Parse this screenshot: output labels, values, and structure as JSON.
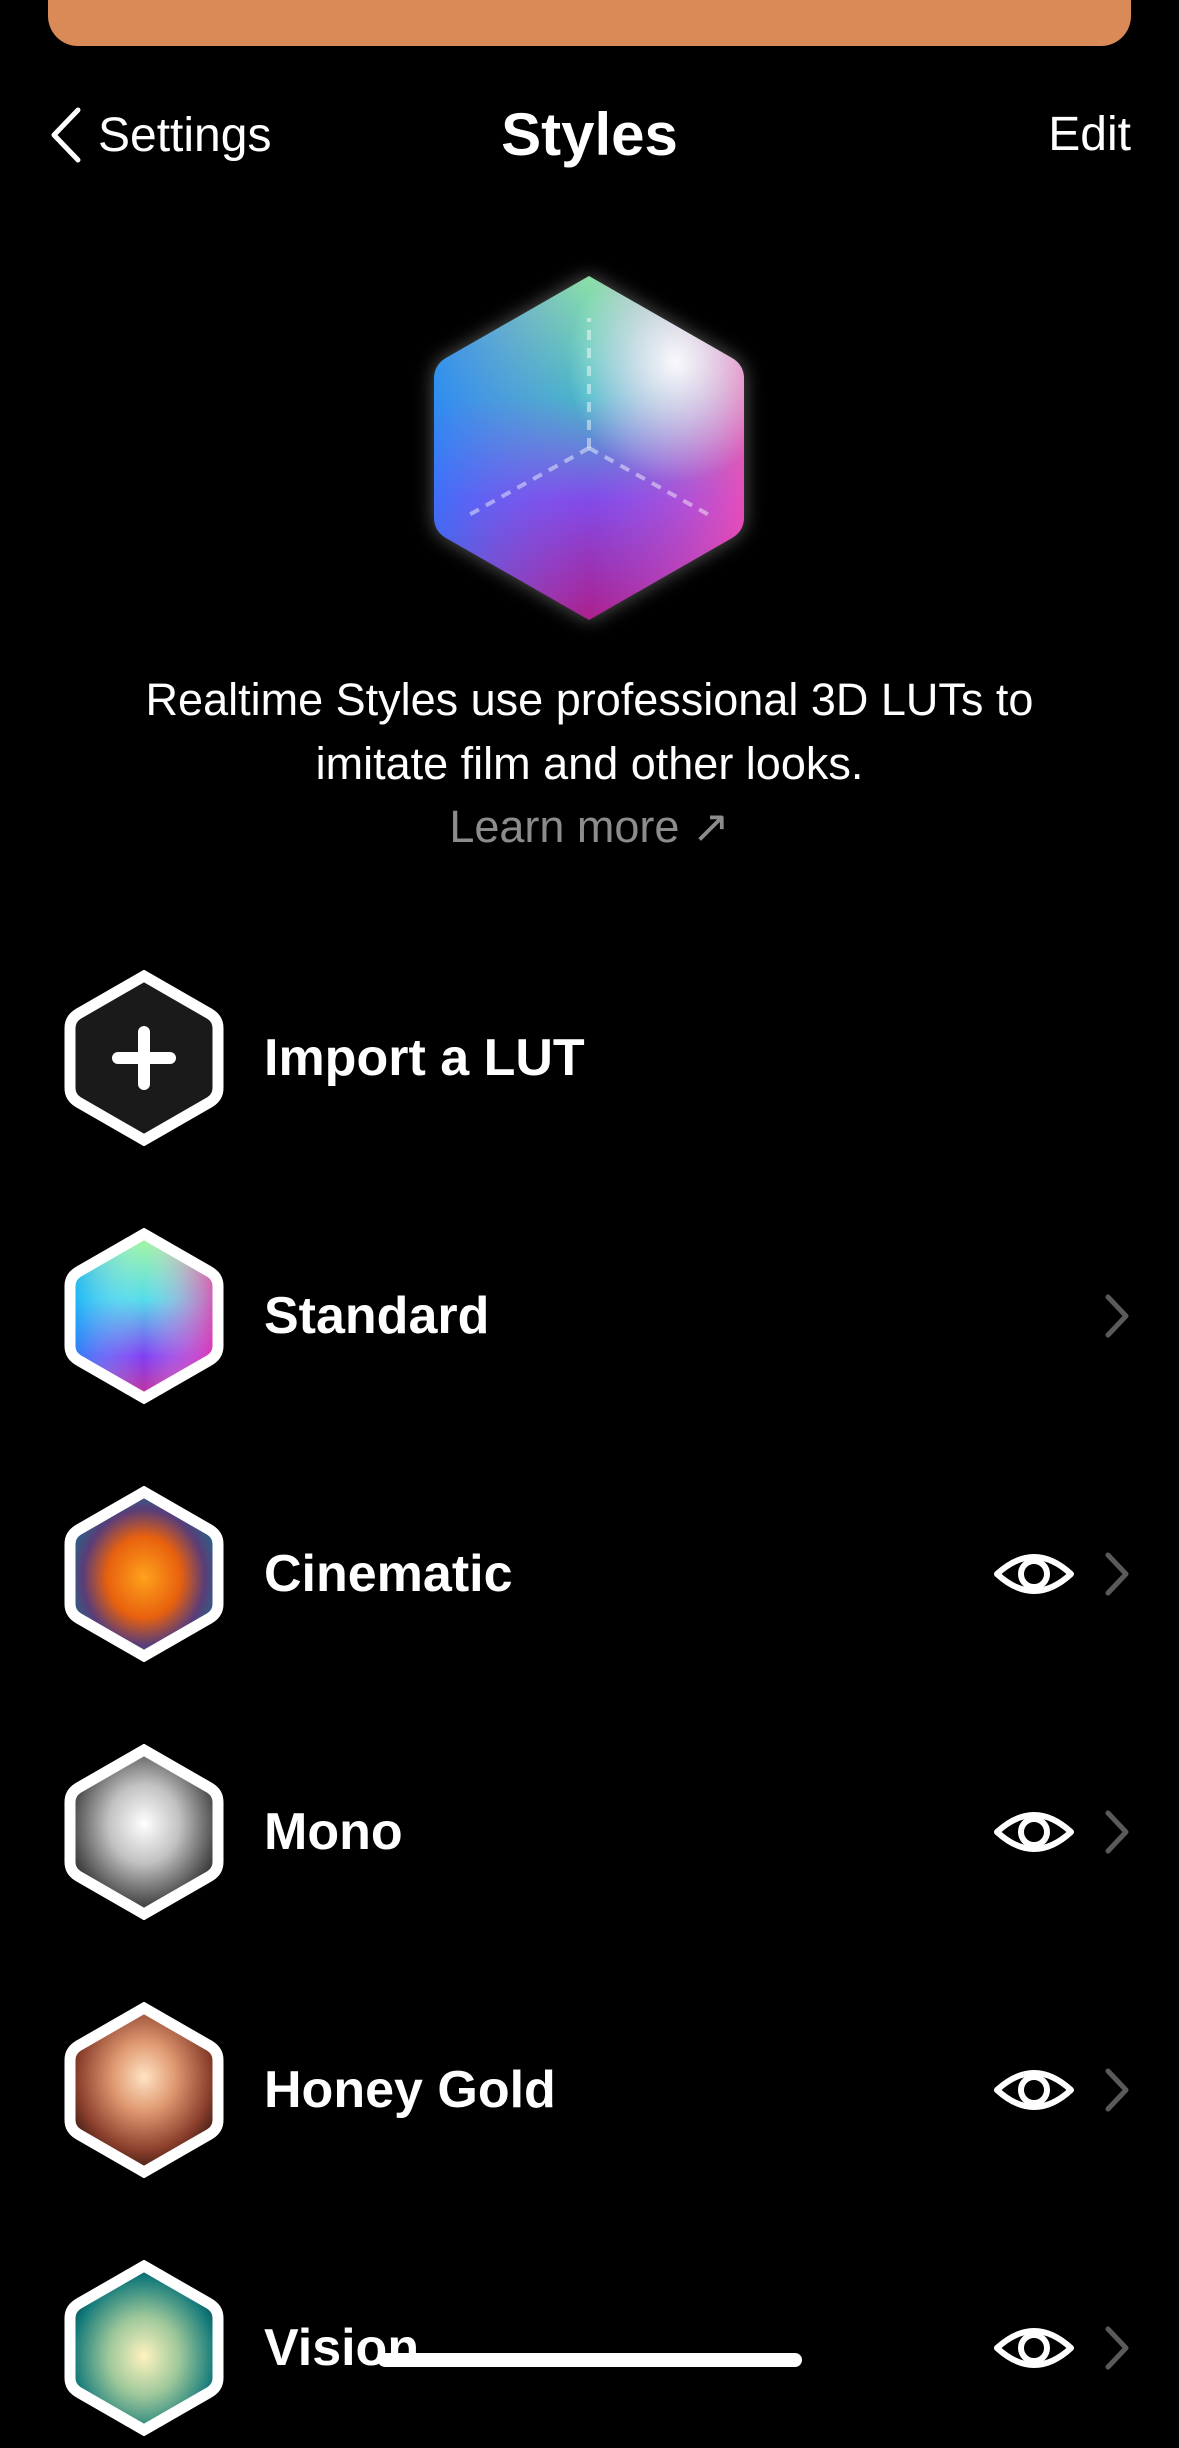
{
  "nav": {
    "back_label": "Settings",
    "title": "Styles",
    "edit_label": "Edit"
  },
  "intro": {
    "description": "Realtime Styles use professional 3D LUTs to imitate film and other looks.",
    "learn_more": "Learn more ↗"
  },
  "styles": [
    {
      "name": "Import a LUT",
      "icon": "plus-hexagon-icon",
      "preview": false,
      "chevron": false
    },
    {
      "name": "Standard",
      "icon": "standard-cube-icon",
      "preview": false,
      "chevron": true
    },
    {
      "name": "Cinematic",
      "icon": "cinematic-cube-icon",
      "preview": true,
      "chevron": true
    },
    {
      "name": "Mono",
      "icon": "mono-cube-icon",
      "preview": true,
      "chevron": true
    },
    {
      "name": "Honey Gold",
      "icon": "honey-gold-cube-icon",
      "preview": true,
      "chevron": true
    },
    {
      "name": "Vision",
      "icon": "vision-cube-icon",
      "preview": true,
      "chevron": true
    }
  ],
  "colors": {
    "background": "#000000",
    "sheet_accent": "#d98a56",
    "secondary_text": "#8c8c8c",
    "chevron": "#5a5a5a"
  }
}
